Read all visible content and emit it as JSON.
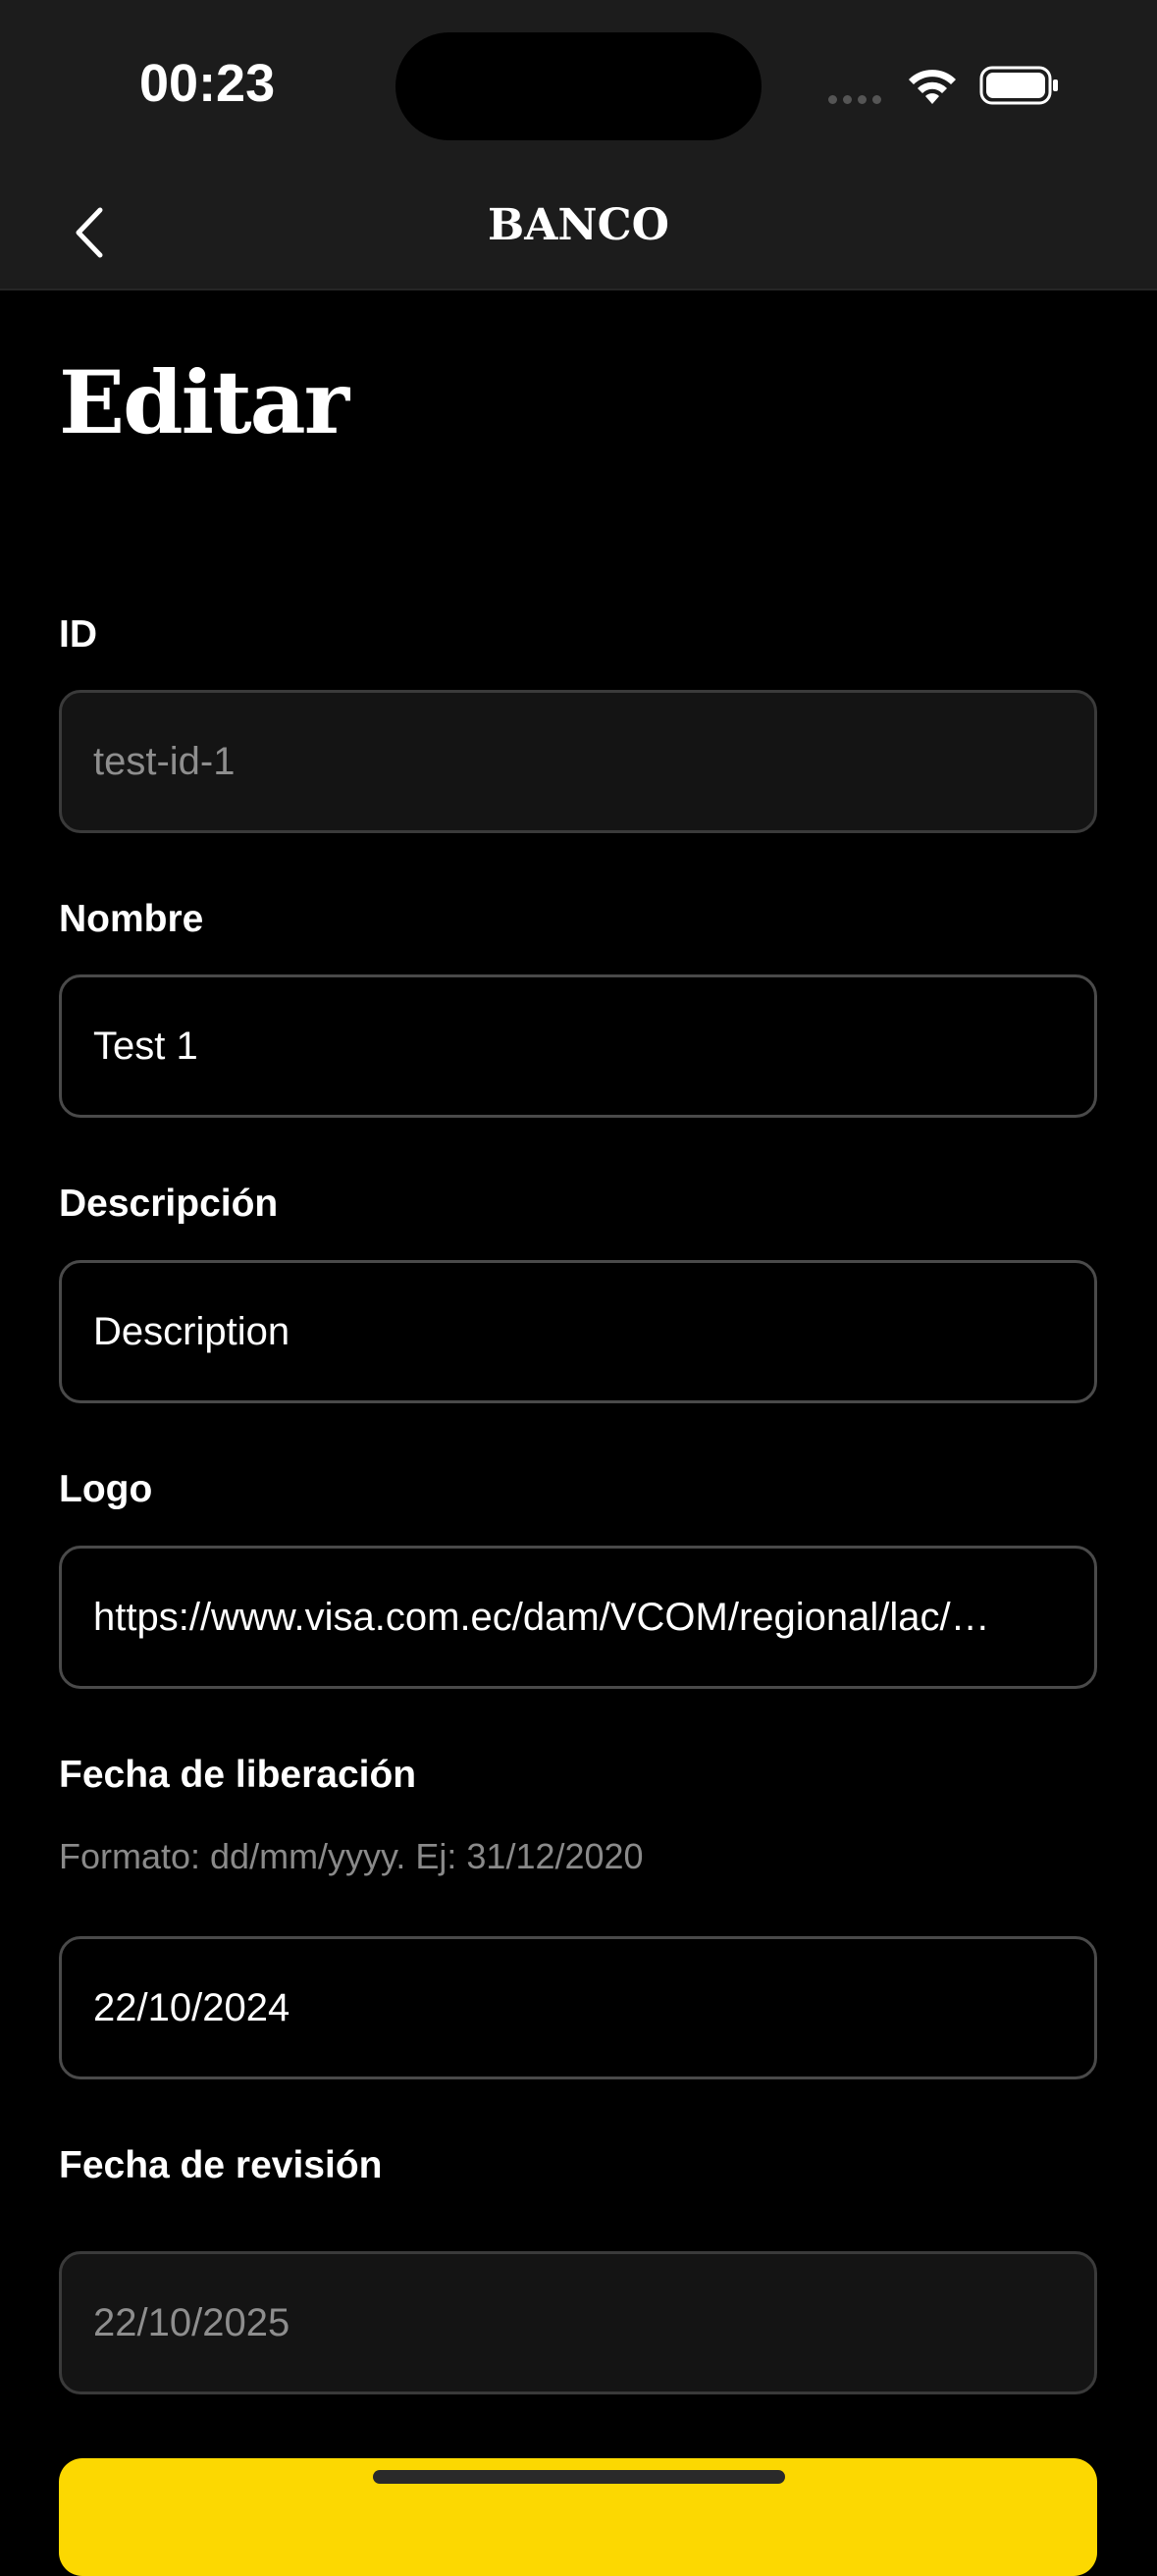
{
  "status": {
    "time": "00:23"
  },
  "nav": {
    "title": "BANCO"
  },
  "page": {
    "title": "Editar"
  },
  "form": {
    "id": {
      "label": "ID",
      "value": "test-id-1"
    },
    "nombre": {
      "label": "Nombre",
      "value": "Test 1"
    },
    "descripcion": {
      "label": "Descripción",
      "value": "Description"
    },
    "logo": {
      "label": "Logo",
      "value": "https://www.visa.com.ec/dam/VCOM/regional/lac/…"
    },
    "fecha_liberacion": {
      "label": "Fecha de liberación",
      "hint": "Formato: dd/mm/yyyy. Ej: 31/12/2020",
      "value": "22/10/2024"
    },
    "fecha_revision": {
      "label": "Fecha de revisión",
      "value": "22/10/2025"
    }
  },
  "colors": {
    "accent": "#fcd801",
    "background": "#000000",
    "bar": "#1c1c1c"
  },
  "icons": {
    "back": "chevron-left-icon",
    "wifi": "wifi-icon",
    "battery": "battery-icon"
  }
}
